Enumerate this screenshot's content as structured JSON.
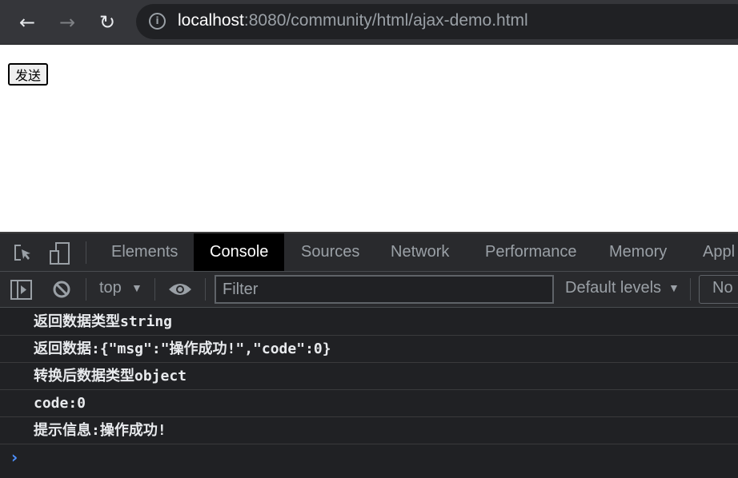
{
  "browser": {
    "url_host": "localhost",
    "url_rest": ":8080/community/html/ajax-demo.html"
  },
  "page": {
    "send_button": "发送"
  },
  "devtools": {
    "tabs": [
      "Elements",
      "Console",
      "Sources",
      "Network",
      "Performance",
      "Memory",
      "Appl"
    ],
    "active_tab": "Console",
    "toolbar": {
      "context": "top",
      "filter_placeholder": "Filter",
      "levels": "Default levels",
      "issues": "No"
    },
    "console_lines": [
      "返回数据类型string",
      "返回数据:{\"msg\":\"操作成功!\",\"code\":0}",
      "转换后数据类型object",
      "code:0",
      "提示信息:操作成功!"
    ],
    "accent_color": "#4d90fe"
  }
}
